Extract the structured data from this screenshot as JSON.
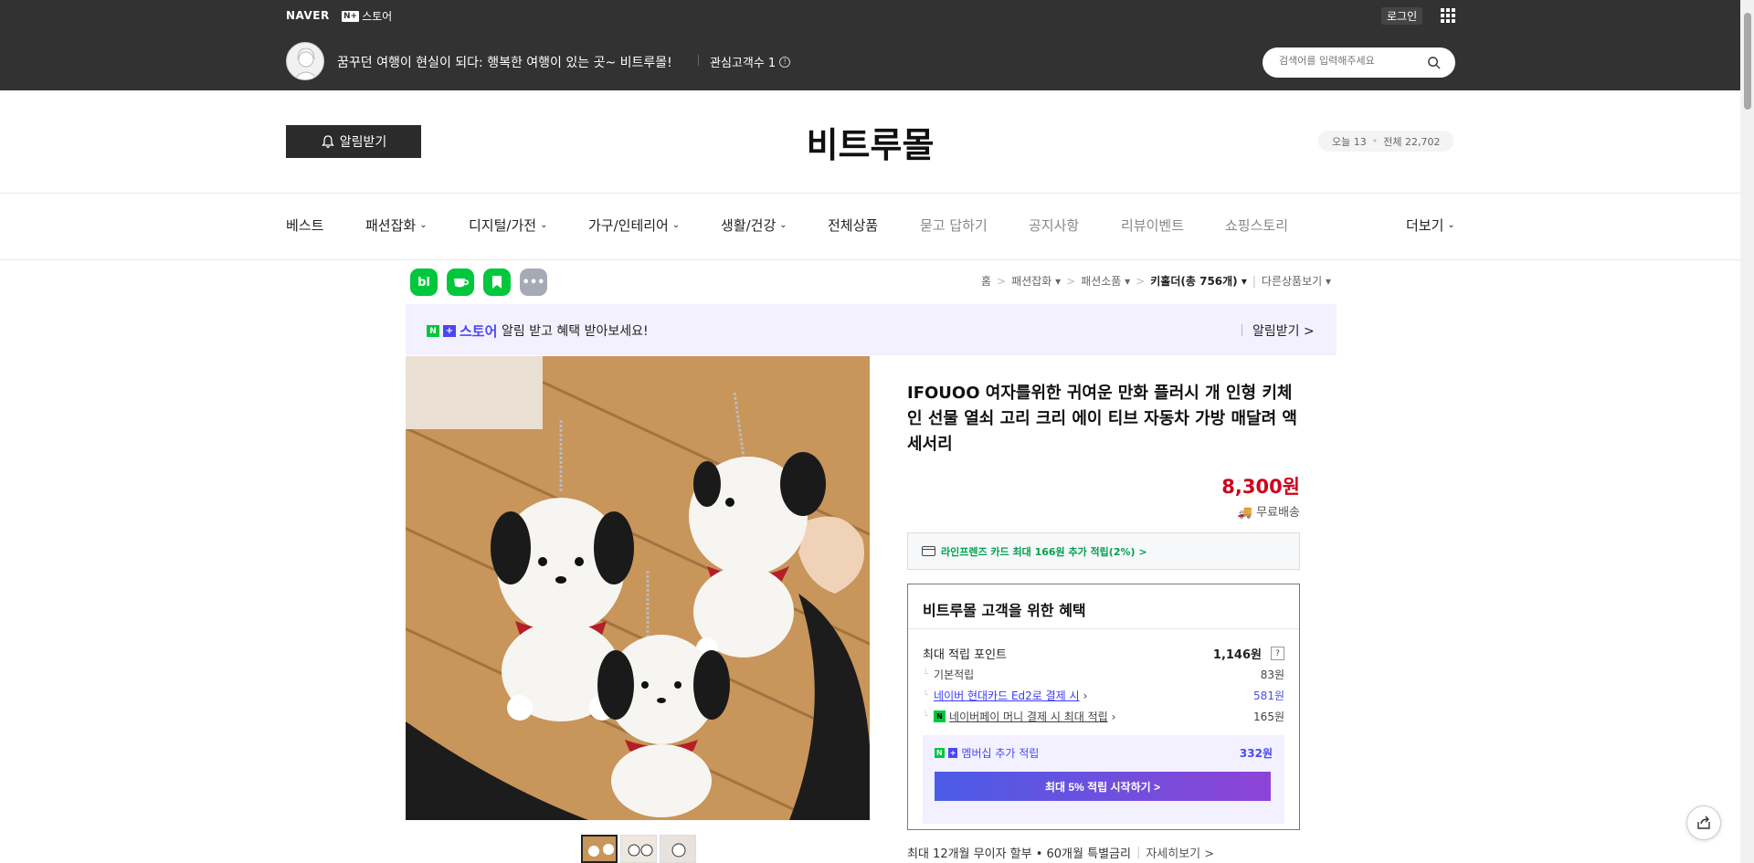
{
  "topbar": {
    "naver": "NAVER",
    "nplus_badge": "N+",
    "nplus_store": "스토어",
    "login": "로그인",
    "store_desc": "꿈꾸던 여행이 현실이 되다: 행복한 여행이 있는 곳~ 비트루몰!",
    "fans_label": "관심고객수 1",
    "search_placeholder": "검색어를 입력해주세요"
  },
  "header": {
    "notify_label": "알림받기",
    "store_name": "비트루몰",
    "visits_today": "오늘 13",
    "visits_total": "전체 22,702"
  },
  "nav": [
    {
      "label": "베스트"
    },
    {
      "label": "패션잡화"
    },
    {
      "label": "디지털/가전"
    },
    {
      "label": "가구/인테리어"
    },
    {
      "label": "생활/건강"
    },
    {
      "label": "전체상품"
    },
    {
      "label": "묻고 답하기"
    },
    {
      "label": "공지사항"
    },
    {
      "label": "리뷰이벤트"
    },
    {
      "label": "쇼핑스토리"
    },
    {
      "label": "더보기"
    }
  ],
  "sns": [
    "bl",
    "cafe",
    "bookmark",
    "more"
  ],
  "breadcrumb": {
    "home": "홈",
    "c1": "패션잡화",
    "c2": "패션소품",
    "c3": "키홀더(총 756개)",
    "other": "다른상품보기"
  },
  "banner": {
    "n_badge": "N",
    "plus_badge": "+",
    "store": "스토어",
    "message": "알림 받고 혜택 받아보세요!",
    "alarm": "알림받기 >"
  },
  "product": {
    "title": "IFOUOO 여자를위한 귀여운 만화 플러시 개 인형 키체인 선물 열쇠 고리 크리 에이 티브 자동차 가방 매달려 액세서리",
    "price": "8,300원",
    "shipping": "무료배송",
    "card_promo": "라인프렌즈 카드 최대 166원 추가 적립(2%) >"
  },
  "benefit": {
    "title": "비트루몰 고객을 위한 혜택",
    "max_points_label": "최대 적립 포인트",
    "max_points_value": "1,146원",
    "basic_label": "기본적립",
    "basic_value": "83원",
    "card_label": "네이버 현대카드 Ed2로 결제 시",
    "card_value": "581원",
    "npay_label": "네이버페이 머니 결제 시 최대 적립",
    "npay_value": "165원",
    "member_label": "멤버십 추가 적립",
    "member_value": "332원",
    "member_button": "최대 5% 적립 시작하기 >"
  },
  "installment": {
    "text": "최대 12개월 무이자 할부 • 60개월 특별금리",
    "more": "자세히보기 >"
  },
  "colors": {
    "topbar": "#323232",
    "price": "#d0021b",
    "naver_green": "#00c73c",
    "nplus_purple": "#4a47f5"
  }
}
